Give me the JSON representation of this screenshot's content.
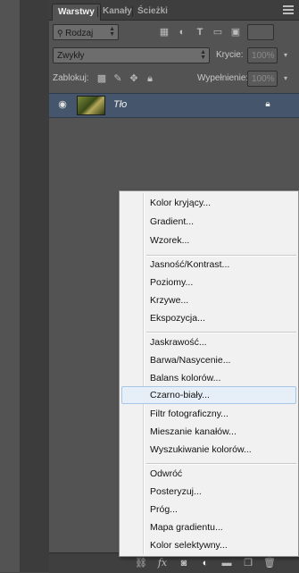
{
  "tabs": [
    {
      "label": "Warstwy",
      "active": true
    },
    {
      "label": "Kanały",
      "active": false
    },
    {
      "label": "Ścieżki",
      "active": false
    }
  ],
  "filter": {
    "kind_label": "Rodzaj"
  },
  "blend": {
    "mode": "Zwykły",
    "opacity_label": "Krycie:",
    "opacity_value": "100%"
  },
  "lock": {
    "label": "Zablokuj:",
    "fill_label": "Wypełnienie:",
    "fill_value": "100%"
  },
  "layer": {
    "name": "Tło"
  },
  "menu": {
    "group1": [
      "Kolor kryjący...",
      "Gradient...",
      "Wzorek..."
    ],
    "group2": [
      "Jasność/Kontrast...",
      "Poziomy...",
      "Krzywe...",
      "Ekspozycja..."
    ],
    "group3": [
      "Jaskrawość...",
      "Barwa/Nasycenie...",
      "Balans kolorów...",
      "Czarno-biały...",
      "Filtr fotograficzny...",
      "Mieszanie kanałów...",
      "Wyszukiwanie kolorów..."
    ],
    "group4": [
      "Odwróć",
      "Posteryzuj...",
      "Próg...",
      "Mapa gradientu...",
      "Kolor selektywny..."
    ],
    "highlighted": "Czarno-biały..."
  },
  "colors": {
    "layer_selected": "#45566c",
    "menu_highlight": "#e6eef8"
  }
}
